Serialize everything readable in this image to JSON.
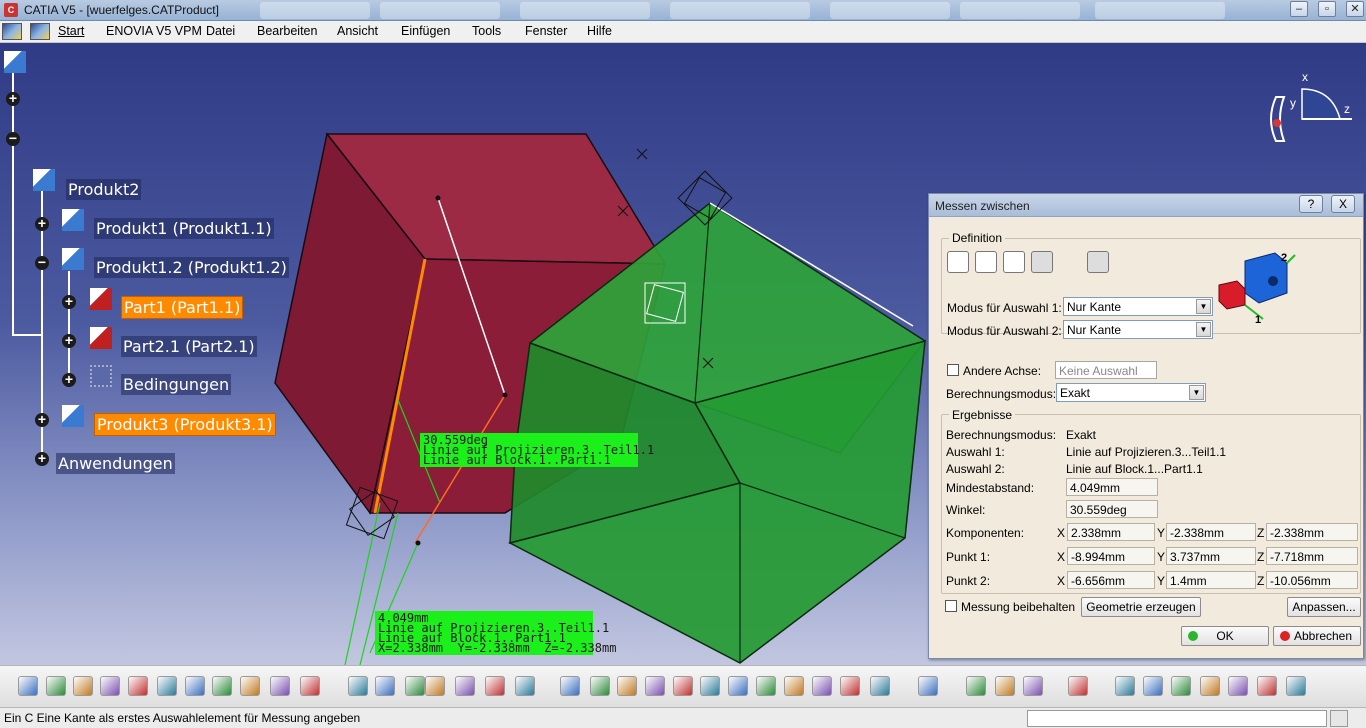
{
  "window": {
    "app_icon_text": "C",
    "title": "CATIA V5 - [wuerfelges.CATProduct]"
  },
  "menu": {
    "items": [
      "Start",
      "ENOVIA V5 VPM",
      "Datei",
      "Bearbeiten",
      "Ansicht",
      "Einfügen",
      "Tools",
      "Fenster",
      "Hilfe"
    ]
  },
  "tree": {
    "nodes": [
      {
        "label": "Produkt2"
      },
      {
        "label": "Produkt1 (Produkt1.1)"
      },
      {
        "label": "Produkt1.2 (Produkt1.2)"
      },
      {
        "label": "Part1 (Part1.1)"
      },
      {
        "label": "Part2.1 (Part2.1)"
      },
      {
        "label": "Bedingungen"
      },
      {
        "label": "Produkt3 (Produkt3.1)"
      },
      {
        "label": "Anwendungen"
      }
    ]
  },
  "compass": {
    "x": "x",
    "y": "y",
    "z": "z"
  },
  "annotations": {
    "angle_label": "30.559deg\nLinie auf Projizieren.3..Teil1.1\nLinie auf Block.1..Part1.1",
    "distance_label": "4.049mm\nLinie auf Projizieren.3..Teil1.1\nLinie auf Block.1..Part1.1\nX=2.338mm  Y=-2.338mm  Z=-2.338mm"
  },
  "dialog": {
    "title": "Messen zwischen",
    "help_btn": "?",
    "close_btn": "X",
    "definition_label": "Definition",
    "modus1_label": "Modus für Auswahl 1:",
    "modus1_value": "Nur Kante",
    "modus2_label": "Modus für Auswahl 2:",
    "modus2_value": "Nur Kante",
    "andere_achse_label": "Andere Achse:",
    "andere_achse_placeholder": "Keine Auswahl",
    "berechnungsmodus_label": "Berechnungsmodus:",
    "berechnungsmodus_value": "Exakt",
    "ergebnisse_label": "Ergebnisse",
    "results": {
      "modus_label": "Berechnungsmodus:",
      "modus_value": "Exakt",
      "auswahl1_label": "Auswahl 1:",
      "auswahl1_value": "Linie auf Projizieren.3...Teil1.1",
      "auswahl2_label": "Auswahl 2:",
      "auswahl2_value": "Linie auf Block.1...Part1.1",
      "mindest_label": "Mindestabstand:",
      "mindest_value": "4.049mm",
      "winkel_label": "Winkel:",
      "winkel_value": "30.559deg",
      "komp_label": "Komponenten:",
      "komp_x": "2.338mm",
      "komp_y": "-2.338mm",
      "komp_z": "-2.338mm",
      "p1_label": "Punkt 1:",
      "p1_x": "-8.994mm",
      "p1_y": "3.737mm",
      "p1_z": "-7.718mm",
      "p2_label": "Punkt 2:",
      "p2_x": "-6.656mm",
      "p2_y": "1.4mm",
      "p2_z": "-10.056mm",
      "x": "X",
      "y": "Y",
      "z": "Z"
    },
    "messung_label": "Messung beibehalten",
    "geometrie_btn": "Geometrie erzeugen",
    "anpassen_btn": "Anpassen...",
    "ok_btn": "OK",
    "abbrechen_btn": "Abbrechen",
    "illustration_numbers": [
      "1",
      "2"
    ]
  },
  "status": {
    "text": "Ein C Eine Kante als erstes Auswahlelement für Messung angeben"
  },
  "colors": {
    "red_cube": "#8b1d38",
    "green_cube": "#1f8a2a",
    "highlight": "#ff8a00",
    "label_green": "#1bf01b"
  }
}
